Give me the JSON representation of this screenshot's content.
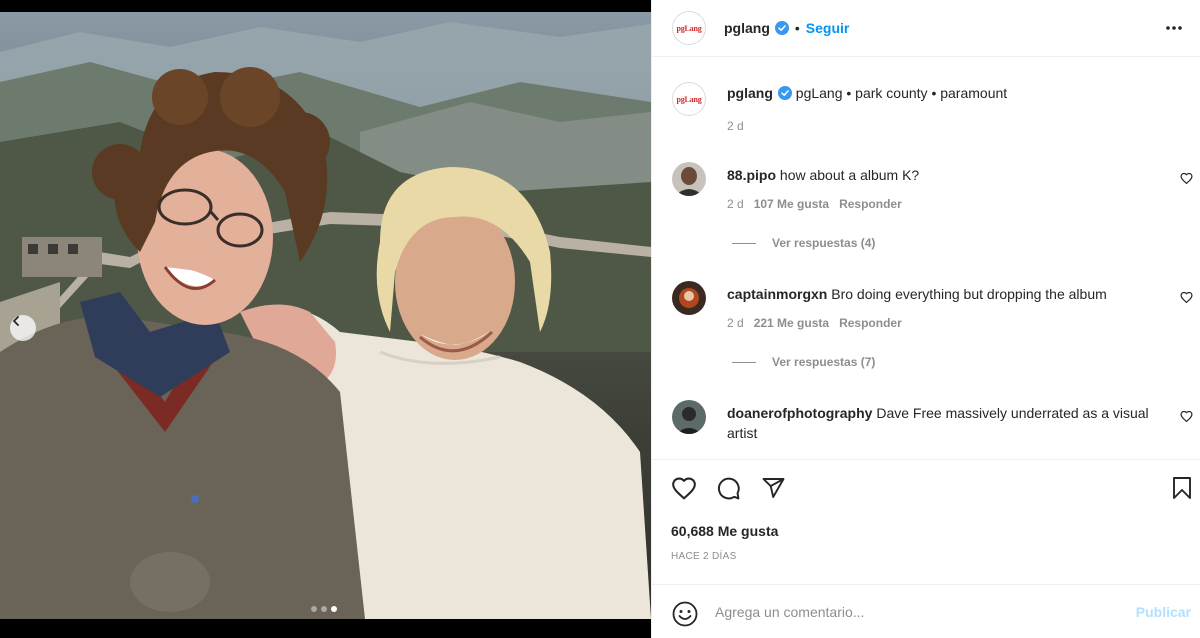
{
  "post": {
    "author": "pglang",
    "author_avatar_text": "pgLang",
    "follow_label": "Seguir",
    "separator": "•",
    "caption_text": "pgLang • park county • paramount",
    "caption_time": "2 d",
    "likes_total": "60,688 Me gusta",
    "post_time": "HACE 2 DÍAS"
  },
  "comments": [
    {
      "user": "88.pipo",
      "text": "how about a album K?",
      "time": "2 d",
      "likes": "107 Me gusta",
      "reply_label": "Responder",
      "view_replies": "Ver respuestas (4)"
    },
    {
      "user": "captainmorgxn",
      "text": "Bro doing everything but dropping the album",
      "time": "2 d",
      "likes": "221 Me gusta",
      "reply_label": "Responder",
      "view_replies": "Ver respuestas (7)"
    },
    {
      "user": "doanerofphotography",
      "text": "Dave Free massively underrated as a visual artist"
    }
  ],
  "add_comment": {
    "placeholder": "Agrega un comentario...",
    "publish_label": "Publicar"
  },
  "carousel": {
    "slides": 3,
    "active_slide": 3
  },
  "icons": {
    "verified": "verified-badge-icon",
    "more": "more-options-icon",
    "like": "heart-icon",
    "comment": "comment-icon",
    "share": "share-icon",
    "save": "bookmark-icon",
    "emoji": "emoji-icon",
    "prev": "chevron-left-icon"
  },
  "colors": {
    "link_blue": "#0095f6",
    "publish_disabled": "#b2dffc",
    "muted": "#8e8e8e",
    "verified": "#3897f0",
    "brand_red": "#d12a2a"
  }
}
